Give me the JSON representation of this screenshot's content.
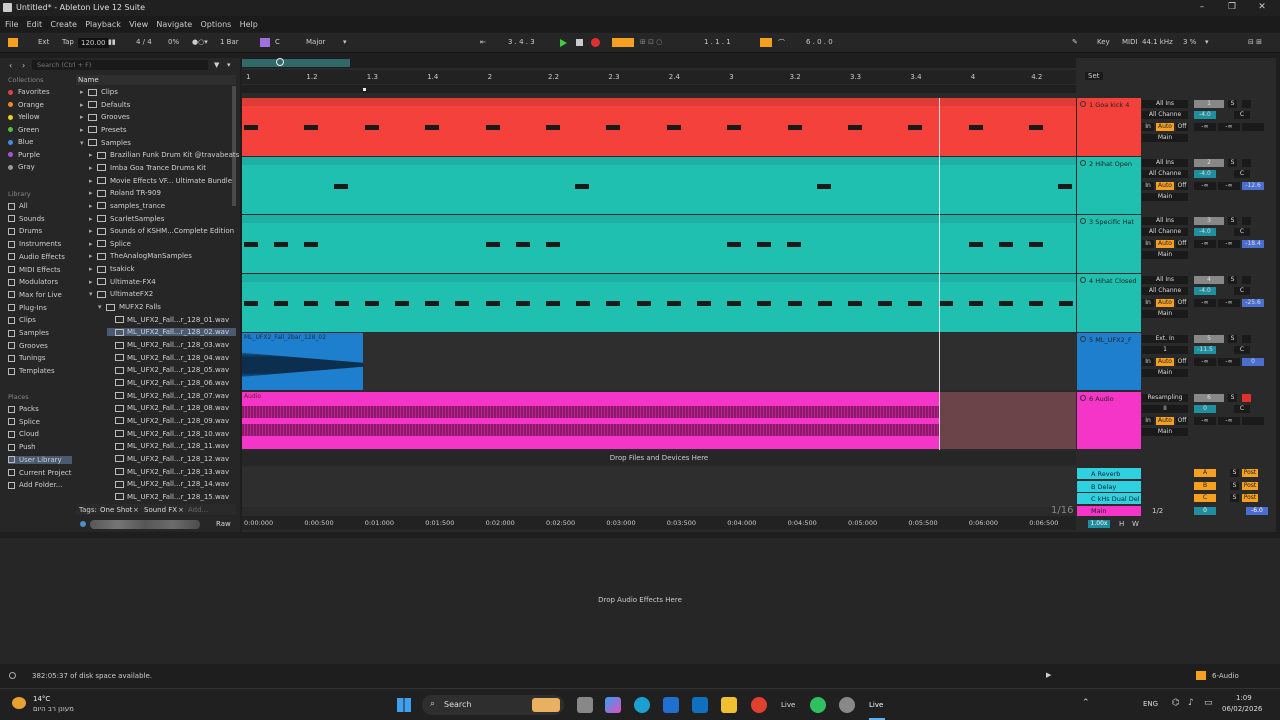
{
  "window": {
    "title": "Untitled* - Ableton Live 12 Suite",
    "minimize": "–",
    "maximize": "❐",
    "close": "✕"
  },
  "menu": [
    "File",
    "Edit",
    "Create",
    "Playback",
    "View",
    "Navigate",
    "Options",
    "Help"
  ],
  "control": {
    "ext": "Ext",
    "tap": "Tap",
    "tempo": "120.00",
    "signature": "4 / 4",
    "groove": "0%",
    "quantize": "1 Bar",
    "key": "C",
    "scale": "Major",
    "position": "3 . 4 . 3",
    "loop_start": "1 . 1 . 1",
    "loop_length": "6 . 0 . 0",
    "key_label": "Key",
    "midi_label": "MIDI",
    "sample_rate": "44.1 kHz",
    "cpu": "3 %"
  },
  "browser": {
    "search_placeholder": "Search (Ctrl + F)",
    "collections_title": "Collections",
    "collections": [
      {
        "label": "Favorites",
        "color": "#e0404a"
      },
      {
        "label": "Orange",
        "color": "#f08a20"
      },
      {
        "label": "Yellow",
        "color": "#e8d020"
      },
      {
        "label": "Green",
        "color": "#50c040"
      },
      {
        "label": "Blue",
        "color": "#3f8fe0"
      },
      {
        "label": "Purple",
        "color": "#b050d0"
      },
      {
        "label": "Gray",
        "color": "#999999"
      }
    ],
    "library_title": "Library",
    "library": [
      "All",
      "Sounds",
      "Drums",
      "Instruments",
      "Audio Effects",
      "MIDI Effects",
      "Modulators",
      "Max for Live",
      "Plug-Ins",
      "Clips",
      "Samples",
      "Grooves",
      "Tunings",
      "Templates"
    ],
    "places_title": "Places",
    "places": [
      "Packs",
      "Splice",
      "Cloud",
      "Push",
      "User Library",
      "Current Project",
      "Add Folder..."
    ],
    "name_header": "Name",
    "tree": [
      {
        "label": "Clips",
        "indent": 0,
        "type": "folder"
      },
      {
        "label": "Defaults",
        "indent": 0,
        "type": "folder"
      },
      {
        "label": "Grooves",
        "indent": 0,
        "type": "folder"
      },
      {
        "label": "Presets",
        "indent": 0,
        "type": "folder"
      },
      {
        "label": "Samples",
        "indent": 0,
        "type": "folder"
      },
      {
        "label": "Brazilian Funk Drum Kit @travabeats",
        "indent": 1,
        "type": "folder"
      },
      {
        "label": "Imba Goa Trance Drums Kit",
        "indent": 1,
        "type": "folder"
      },
      {
        "label": "Movie Effects VF... Ultimate Bundle",
        "indent": 1,
        "type": "folder"
      },
      {
        "label": "Roland TR-909",
        "indent": 1,
        "type": "folder"
      },
      {
        "label": "samples_trance",
        "indent": 1,
        "type": "folder"
      },
      {
        "label": "ScarletSamples",
        "indent": 1,
        "type": "folder"
      },
      {
        "label": "Sounds of KSHM...Complete Edition",
        "indent": 1,
        "type": "folder"
      },
      {
        "label": "Splice",
        "indent": 1,
        "type": "folder"
      },
      {
        "label": "TheAnalogManSamples",
        "indent": 1,
        "type": "folder"
      },
      {
        "label": "tsakick",
        "indent": 1,
        "type": "folder"
      },
      {
        "label": "Ultimate-FX4",
        "indent": 1,
        "type": "folder"
      },
      {
        "label": "UltimateFX2",
        "indent": 1,
        "type": "folder"
      },
      {
        "label": "MUFX2 Falls",
        "indent": 2,
        "type": "folder"
      },
      {
        "label": "ML_UFX2_Fall...r_128_01.wav",
        "indent": 3,
        "type": "wav"
      },
      {
        "label": "ML_UFX2_Fall...r_128_02.wav",
        "indent": 3,
        "type": "wav"
      },
      {
        "label": "ML_UFX2_Fall...r_128_03.wav",
        "indent": 3,
        "type": "wav"
      },
      {
        "label": "ML_UFX2_Fall...r_128_04.wav",
        "indent": 3,
        "type": "wav"
      },
      {
        "label": "ML_UFX2_Fall...r_128_05.wav",
        "indent": 3,
        "type": "wav"
      },
      {
        "label": "ML_UFX2_Fall...r_128_06.wav",
        "indent": 3,
        "type": "wav"
      },
      {
        "label": "ML_UFX2_Fall...r_128_07.wav",
        "indent": 3,
        "type": "wav"
      },
      {
        "label": "ML_UFX2_Fall...r_128_08.wav",
        "indent": 3,
        "type": "wav"
      },
      {
        "label": "ML_UFX2_Fall...r_128_09.wav",
        "indent": 3,
        "type": "wav"
      },
      {
        "label": "ML_UFX2_Fall...r_128_10.wav",
        "indent": 3,
        "type": "wav"
      },
      {
        "label": "ML_UFX2_Fall...r_128_11.wav",
        "indent": 3,
        "type": "wav"
      },
      {
        "label": "ML_UFX2_Fall...r_128_12.wav",
        "indent": 3,
        "type": "wav"
      },
      {
        "label": "ML_UFX2_Fall...r_128_13.wav",
        "indent": 3,
        "type": "wav"
      },
      {
        "label": "ML_UFX2_Fall...r_128_14.wav",
        "indent": 3,
        "type": "wav"
      },
      {
        "label": "ML_UFX2_Fall...r_128_15.wav",
        "indent": 3,
        "type": "wav"
      }
    ],
    "tags_label": "Tags:",
    "tags": [
      "One Shot",
      "Sound FX"
    ],
    "add_tag": "Add...",
    "raw": "Raw"
  },
  "ruler": [
    "1",
    "1.2",
    "1.3",
    "1.4",
    "2",
    "2.2",
    "2.3",
    "2.4",
    "3",
    "3.2",
    "3.3",
    "3.4",
    "4",
    "4.2"
  ],
  "set_label": "Set",
  "tracks": [
    {
      "name": "1 Goa kick 4",
      "color": "#f5413c",
      "input": "All Ins",
      "channel": "All Channe",
      "num": "1",
      "vol": "-4.0",
      "pan": "C",
      "peak": "",
      "monitor_in": "In",
      "monitor_auto": "Auto",
      "monitor_off": "Off",
      "out": "Main",
      "minf": "-∞",
      "minf2": "-∞"
    },
    {
      "name": "2 Hihat Open",
      "color": "#1fc0b0",
      "input": "All Ins",
      "channel": "All Channe",
      "num": "2",
      "vol": "-4.0",
      "pan": "C",
      "peak": "-12.6",
      "monitor_in": "In",
      "monitor_auto": "Auto",
      "monitor_off": "Off",
      "out": "Main",
      "minf": "-∞",
      "minf2": "-∞"
    },
    {
      "name": "3 Specific Hat",
      "color": "#1fc0b0",
      "input": "All Ins",
      "channel": "All Channe",
      "num": "3",
      "vol": "-4.0",
      "pan": "C",
      "peak": "-18.4",
      "monitor_in": "In",
      "monitor_auto": "Auto",
      "monitor_off": "Off",
      "out": "Main",
      "minf": "-∞",
      "minf2": "-∞"
    },
    {
      "name": "4 Hihat Closed",
      "color": "#1fc0b0",
      "input": "All Ins",
      "channel": "All Channe",
      "num": "4",
      "vol": "-4.0",
      "pan": "C",
      "peak": "-25.6",
      "monitor_in": "In",
      "monitor_auto": "Auto",
      "monitor_off": "Off",
      "out": "Main",
      "minf": "-∞",
      "minf2": "-∞"
    },
    {
      "name": "5 ML_UFX2_F",
      "color": "#1f7fcf",
      "input": "Ext. In",
      "channel": "1",
      "num": "5",
      "vol": "-11.5",
      "pan": "C",
      "peak": "0",
      "monitor_in": "In",
      "monitor_auto": "Auto",
      "monitor_off": "Off",
      "out": "Main",
      "minf": "-∞",
      "minf2": "-∞"
    },
    {
      "name": "6 Audio",
      "color": "#f534c8",
      "input": "Resampling",
      "channel": "II",
      "num": "6",
      "vol": "0",
      "pan": "C",
      "peak": "",
      "monitor_in": "In",
      "monitor_auto": "Auto",
      "monitor_off": "Off",
      "out": "Main",
      "minf": "-∞",
      "minf2": "-∞"
    }
  ],
  "clips": {
    "track5": "ML_UFX2_Fall_2bar_128_02",
    "track6": "Audio"
  },
  "drop_files": "Drop Files and Devices Here",
  "returns": [
    {
      "name": "A Reverb",
      "letter": "A",
      "post": "Post"
    },
    {
      "name": "B Delay",
      "letter": "B",
      "post": "Post"
    },
    {
      "name": "C kHs Dual Del",
      "letter": "C",
      "post": "Post"
    }
  ],
  "main": {
    "name": "Main",
    "quant": "1/2",
    "vol": "0",
    "peak": "-6.0",
    "zoom": "1.00x",
    "h": "H",
    "w": "W",
    "s": "S"
  },
  "grid_label": "1/16",
  "time_ruler": [
    "0:00:000",
    "0:00:500",
    "0:01:000",
    "0:01:500",
    "0:02:000",
    "0:02:500",
    "0:03:000",
    "0:03:500",
    "0:04:000",
    "0:04:500",
    "0:05:000",
    "0:05:500",
    "0:06:000",
    "0:06:500"
  ],
  "devices_hint": "Drop Audio Effects Here",
  "status": {
    "disk": "382:05:37 of disk space available.",
    "selected_track": "6-Audio"
  },
  "taskbar": {
    "temp": "14°C",
    "weather": "מעונן רב היום",
    "search": "Search",
    "live1": "Live",
    "live2": "Live",
    "lang": "ENG",
    "time": "1:09",
    "date": "06/02/2026"
  }
}
